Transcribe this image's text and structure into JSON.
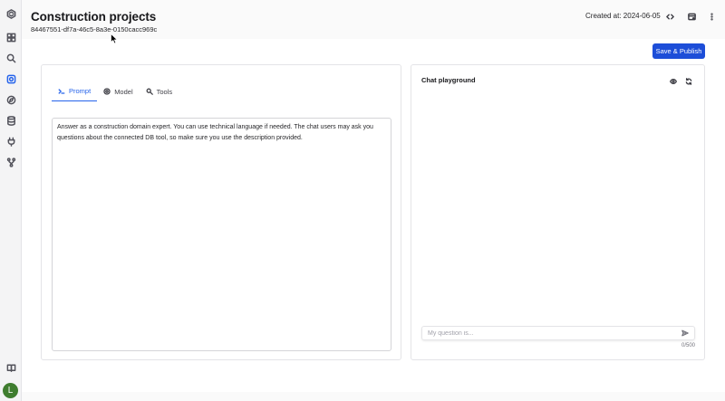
{
  "header": {
    "title": "Construction projects",
    "id": "84467551-df7a-46c5-8a3e-0150cacc969c",
    "created": "Created at: 2024-06-05"
  },
  "toolbar": {
    "publish_label": "Save & Publish"
  },
  "tabs": [
    {
      "label": "Prompt",
      "icon": "terminal-icon",
      "active": true
    },
    {
      "label": "Model",
      "icon": "model-icon",
      "active": false
    },
    {
      "label": "Tools",
      "icon": "tools-icon",
      "active": false
    }
  ],
  "prompt": {
    "text": "Answer as a construction domain expert. You can use technical language if needed. The chat users may ask you questions about the connected DB tool, so make sure you use the description provided."
  },
  "chat": {
    "title": "Chat playground",
    "placeholder": "My question is...",
    "counter": "0/500"
  },
  "user": {
    "initial": "L"
  },
  "colors": {
    "accent": "#2563eb",
    "publish": "#1d4ed8",
    "avatar": "#3f7d2f"
  }
}
